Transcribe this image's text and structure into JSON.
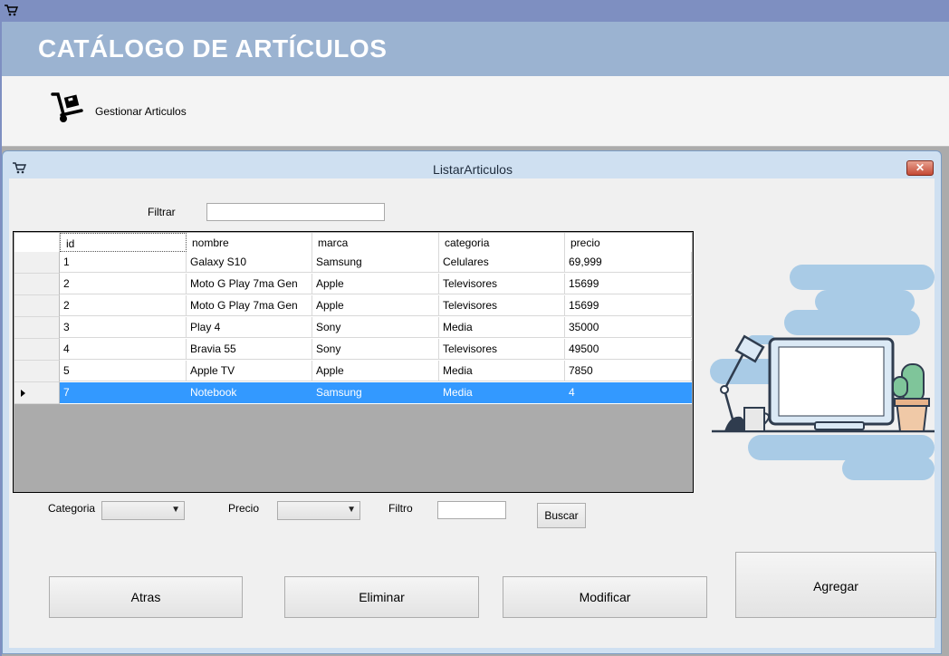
{
  "app": {
    "title": "CATÁLOGO DE ARTÍCULOS",
    "menu": [
      {
        "label": "Gestionar Articulos",
        "icon": "hand-truck-icon"
      }
    ]
  },
  "window": {
    "title": "ListarArticulos",
    "close_glyph": "✕"
  },
  "filter": {
    "label": "Filtrar",
    "value": ""
  },
  "grid": {
    "columns": [
      "id",
      "nombre",
      "marca",
      "categoria",
      "precio"
    ],
    "rows": [
      [
        "1",
        "Galaxy S10",
        "Samsung",
        "Celulares",
        "69,999"
      ],
      [
        "2",
        "Moto G Play 7ma Gen",
        "Apple",
        "Televisores",
        "15699"
      ],
      [
        "2",
        "Moto G Play 7ma Gen",
        "Apple",
        "Televisores",
        "15699"
      ],
      [
        "3",
        "Play 4",
        "Sony",
        "Media",
        "35000"
      ],
      [
        "4",
        "Bravia 55",
        "Sony",
        "Televisores",
        "49500"
      ],
      [
        "5",
        "Apple TV",
        "Apple",
        "Media",
        "7850"
      ],
      [
        "7",
        "Notebook",
        "Samsung",
        "Media",
        "4"
      ]
    ],
    "selected_row": 6
  },
  "search": {
    "categoria_label": "Categoria",
    "categoria_value": "",
    "precio_label": "Precio",
    "precio_value": "",
    "filtro_label": "Filtro",
    "filtro_value": "",
    "buscar_label": "Buscar"
  },
  "buttons": {
    "atras": "Atras",
    "eliminar": "Eliminar",
    "modificar": "Modificar",
    "agregar": "Agregar"
  },
  "colors": {
    "header": "#9bb3d1",
    "titlebar": "#7e8fc1",
    "selection": "#3399ff",
    "illustration": "#a9cbe6"
  }
}
